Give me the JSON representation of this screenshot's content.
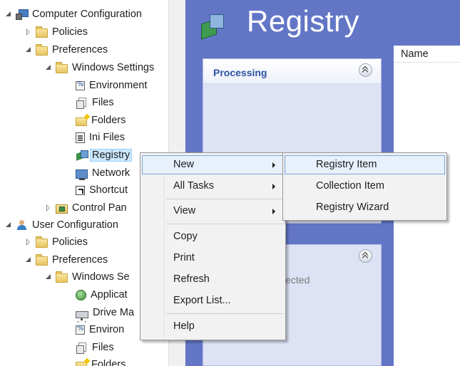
{
  "tree": {
    "computer_configuration": "Computer Configuration",
    "policies": "Policies",
    "preferences": "Preferences",
    "windows_settings": "Windows Settings",
    "environment": "Environment",
    "files": "Files",
    "folders": "Folders",
    "ini_files": "Ini Files",
    "registry": "Registry",
    "network": "Network",
    "shortcuts": "Shortcut",
    "control_panel": "Control Pan",
    "user_configuration": "User Configuration",
    "user_policies": "Policies",
    "user_preferences": "Preferences",
    "user_windows_settings": "Windows Se",
    "applications": "Applicat",
    "drive_maps": "Drive Ma",
    "user_environment": "Environ",
    "user_files": "Files",
    "user_folders": "Folders"
  },
  "right_pane": {
    "title": "Registry",
    "processing_box_title": "Processing",
    "second_box_partial_text": "lected",
    "list_column_name": "Name"
  },
  "context_menu": {
    "new": "New",
    "all_tasks": "All Tasks",
    "view": "View",
    "copy": "Copy",
    "print": "Print",
    "refresh": "Refresh",
    "export_list": "Export List...",
    "help": "Help"
  },
  "submenu_new": {
    "registry_item": "Registry Item",
    "collection_item": "Collection Item",
    "registry_wizard": "Registry Wizard"
  },
  "colors": {
    "right_pane_bg": "#6376c6",
    "processing_title": "#2b53a3",
    "menu_bg": "#f2f2f2",
    "menu_highlight": "#e7f0fb",
    "selection": "#cce8ff"
  },
  "icons": {
    "computer": "computer-icon",
    "folder": "folder-icon",
    "registry": "registry-icon",
    "user": "user-icon"
  }
}
